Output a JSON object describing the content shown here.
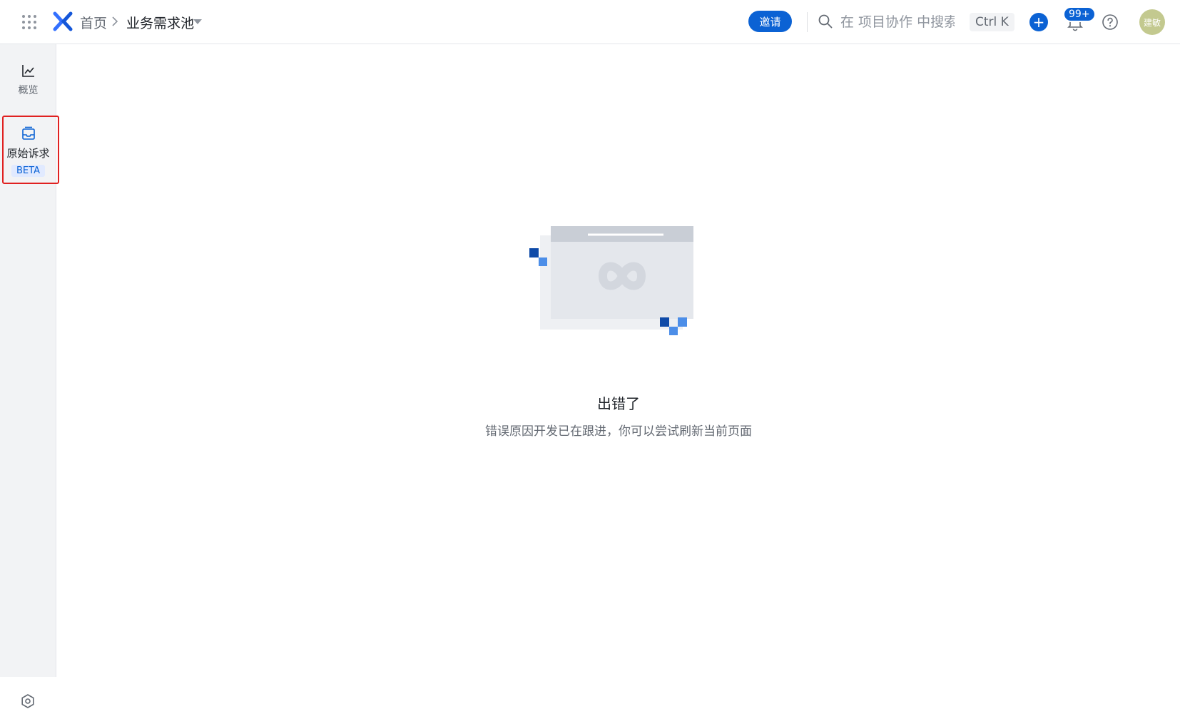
{
  "header": {
    "breadcrumb_home": "首页",
    "breadcrumb_current": "业务需求池",
    "invite_label": "邀请",
    "search_placeholder": "在 项目协作 中搜索",
    "shortcut_label": "Ctrl K",
    "add_label": "+",
    "notification_count": "99+",
    "avatar_text": "建敏"
  },
  "sidebar": {
    "items": [
      {
        "label": "概览",
        "icon": "chart-line-icon"
      },
      {
        "label": "原始诉求",
        "icon": "inbox-icon",
        "tag": "BETA",
        "highlighted": true
      }
    ],
    "settings_icon": "settings-icon"
  },
  "error": {
    "title": "出错了",
    "description": "错误原因开发已在跟进，你可以尝试刷新当前页面"
  },
  "colors": {
    "accent": "#0b62d4",
    "highlight_border": "#e02020",
    "sidebar_bg": "#f2f3f5"
  }
}
